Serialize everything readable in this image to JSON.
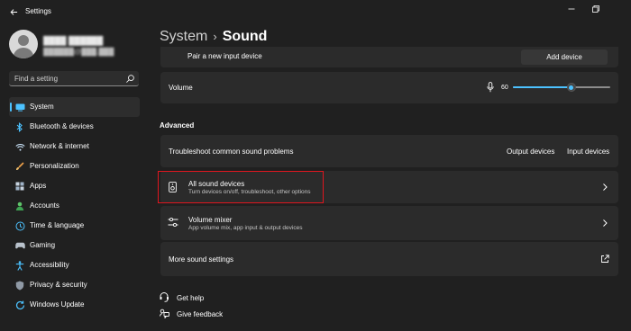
{
  "titlebar": {
    "app_title": "Settings",
    "back_icon": "arrow-left-icon",
    "minimize_icon": "minimize-icon",
    "maximize_icon": "restore-icon"
  },
  "profile": {
    "name": "████ ██████",
    "email": "██████@███.███"
  },
  "search": {
    "placeholder": "Find a setting",
    "icon": "search-icon"
  },
  "sidebar": {
    "items": [
      {
        "label": "System",
        "icon": "monitor-icon",
        "active": true
      },
      {
        "label": "Bluetooth & devices",
        "icon": "bluetooth-icon"
      },
      {
        "label": "Network & internet",
        "icon": "wifi-icon"
      },
      {
        "label": "Personalization",
        "icon": "paintbrush-icon"
      },
      {
        "label": "Apps",
        "icon": "apps-icon"
      },
      {
        "label": "Accounts",
        "icon": "person-icon"
      },
      {
        "label": "Time & language",
        "icon": "globe-clock-icon"
      },
      {
        "label": "Gaming",
        "icon": "gamepad-icon"
      },
      {
        "label": "Accessibility",
        "icon": "accessibility-icon"
      },
      {
        "label": "Privacy & security",
        "icon": "shield-icon"
      },
      {
        "label": "Windows Update",
        "icon": "update-icon"
      }
    ]
  },
  "breadcrumb": {
    "parent": "System",
    "separator": "›",
    "current": "Sound"
  },
  "input_device": {
    "label": "Pair a new input device",
    "button": "Add device"
  },
  "volume": {
    "label": "Volume",
    "value": "60",
    "level": 60,
    "icon": "microphone-icon"
  },
  "advanced": {
    "heading": "Advanced",
    "troubleshoot": {
      "label": "Troubleshoot common sound problems",
      "output_link": "Output devices",
      "input_link": "Input devices"
    },
    "all_sound_devices": {
      "title": "All sound devices",
      "subtitle": "Turn devices on/off, troubleshoot, other options",
      "icon": "speaker-device-icon"
    },
    "volume_mixer": {
      "title": "Volume mixer",
      "subtitle": "App volume mix, app input & output devices",
      "icon": "mixer-sliders-icon"
    },
    "more_settings": {
      "label": "More sound settings",
      "icon": "external-link-icon"
    }
  },
  "footer": {
    "help": "Get help",
    "feedback": "Give feedback"
  },
  "colors": {
    "accent": "#4cc2ff",
    "highlight": "#e0161f",
    "background": "#202020",
    "card": "#2b2b2b"
  }
}
